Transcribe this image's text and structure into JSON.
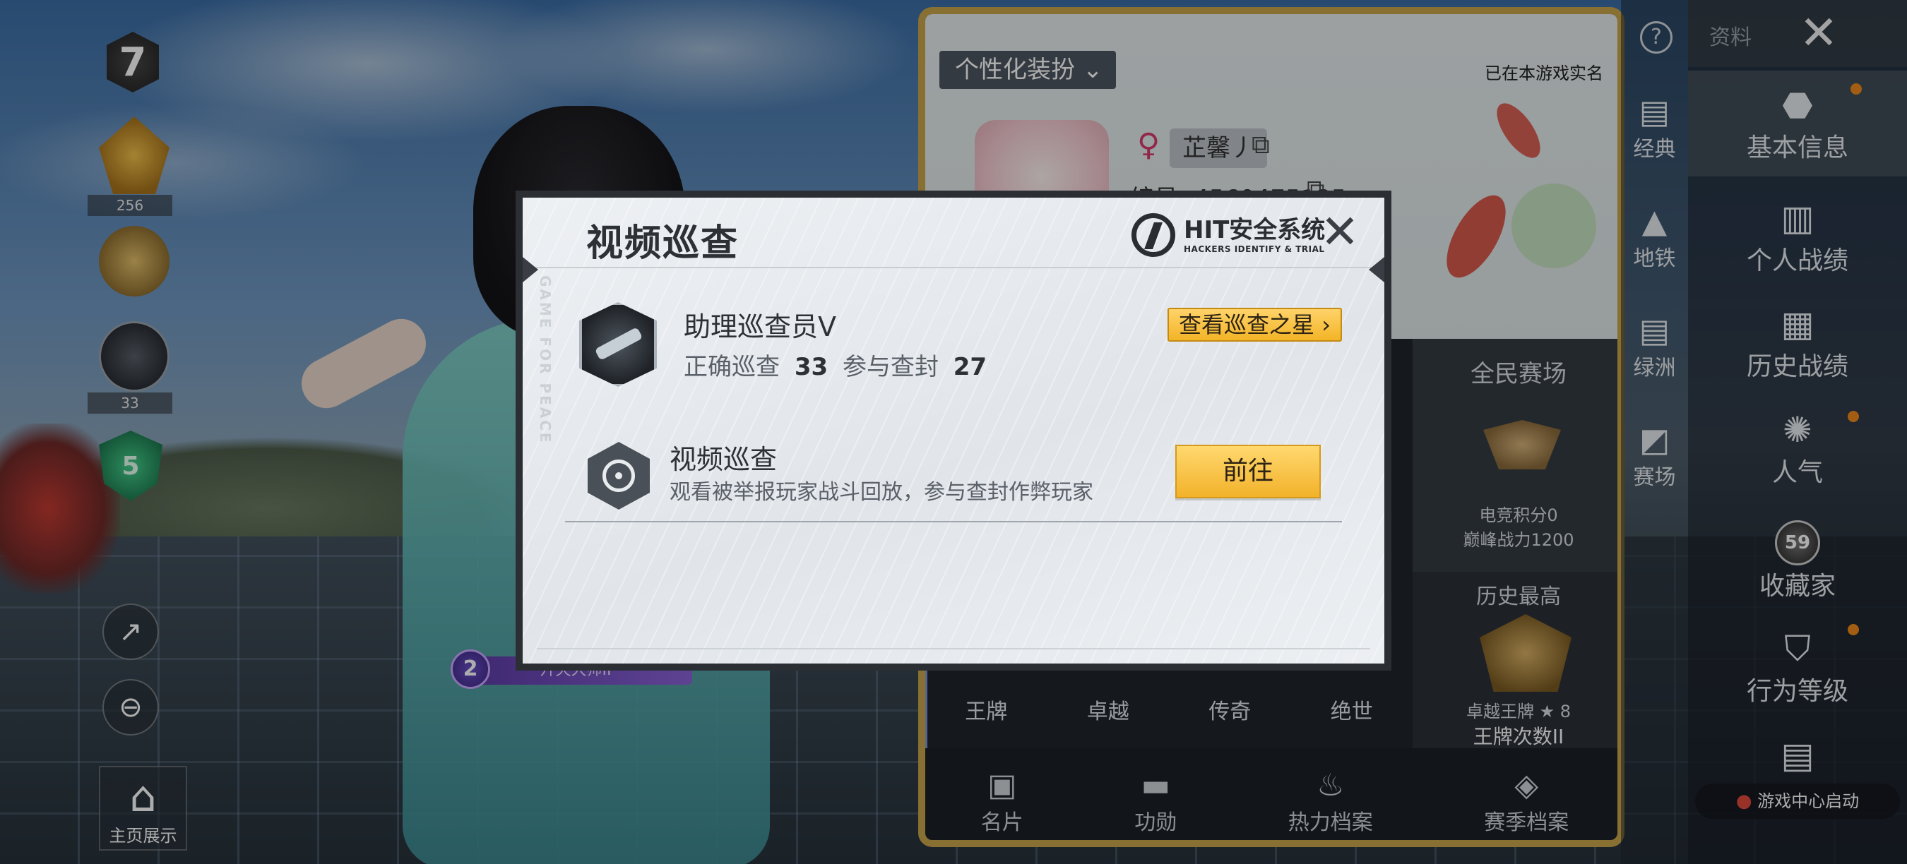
{
  "left_column": {
    "tier_level": "7",
    "gold_badge_count": "256",
    "weapon_badge_count": "33",
    "shield_level": "5",
    "home_display_label": "主页展示"
  },
  "character": {
    "level": "2",
    "title": "歼灭大师II"
  },
  "profile_card": {
    "costume_tab": "个性化装扮",
    "realname_note": "已在本游戏实名",
    "nickname": "芷馨丿",
    "player_id": "编号: 4560475135",
    "arena_title": "全民赛场",
    "esports_score": "电竞积分0",
    "peak_power": "巅峰战力1200",
    "history_title": "历史最高",
    "history_tier": "卓越王牌 ★ 8",
    "ace_count": "王牌次数II",
    "tiers": [
      "王牌",
      "卓越",
      "传奇",
      "绝世"
    ],
    "bottom_tabs": [
      "名片",
      "功勋",
      "热力档案",
      "赛季档案"
    ]
  },
  "right_rail": {
    "items": [
      "经典",
      "地铁",
      "绿洲",
      "赛场"
    ]
  },
  "main_nav": {
    "profile_label": "资料",
    "items": [
      "基本信息",
      "个人战绩",
      "历史战绩",
      "人气",
      "收藏家",
      "行为等级"
    ],
    "collector_level": "59",
    "game_center_label": "游戏中心启动"
  },
  "dialog": {
    "title": "视频巡查",
    "logo_title": "HIT安全系统",
    "logo_subtitle": "HACKERS IDENTIFY & TRIAL",
    "watermark": "GAME FOR PEACE",
    "inspector_rank": "助理巡查员V",
    "correct_label": "正确巡查",
    "correct_count": "33",
    "ban_label": "参与查封",
    "ban_count": "27",
    "star_button": "查看巡查之星",
    "patrol_title": "视频巡查",
    "patrol_desc": "观看被举报玩家战斗回放，参与查封作弊玩家",
    "go_button": "前往"
  },
  "colors": {
    "accent_gold": "#f3b426",
    "dialog_bg": "#e8ebee",
    "frame_gold": "#c9a44a"
  }
}
